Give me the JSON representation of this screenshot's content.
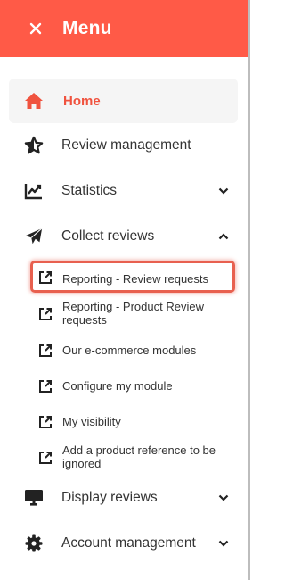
{
  "header": {
    "title": "Menu",
    "close_icon": "close-icon",
    "background": "#ff5a47"
  },
  "nav": {
    "home": {
      "label": "Home",
      "icon": "home-icon",
      "active": true,
      "accent": "#f0533f"
    },
    "review_management": {
      "label": "Review management",
      "icon": "star-outline-icon"
    },
    "statistics": {
      "label": "Statistics",
      "icon": "chart-line-icon",
      "expandable": true,
      "expanded": false
    },
    "collect_reviews": {
      "label": "Collect reviews",
      "icon": "paper-plane-icon",
      "expandable": true,
      "expanded": true
    },
    "display_reviews": {
      "label": "Display reviews",
      "icon": "monitor-icon",
      "expandable": true,
      "expanded": false
    },
    "account_management": {
      "label": "Account management",
      "icon": "gear-icon",
      "expandable": true,
      "expanded": false
    }
  },
  "collect_reviews_items": [
    {
      "label": "Reporting - Review requests",
      "icon": "external-link-icon",
      "highlighted": true
    },
    {
      "label": "Reporting - Product Review requests",
      "icon": "external-link-icon"
    },
    {
      "label": "Our e-commerce modules",
      "icon": "external-link-icon"
    },
    {
      "label": "Configure my module",
      "icon": "external-link-icon"
    },
    {
      "label": "My visibility",
      "icon": "external-link-icon"
    },
    {
      "label": "Add a product reference to be ignored",
      "icon": "external-link-icon"
    }
  ]
}
